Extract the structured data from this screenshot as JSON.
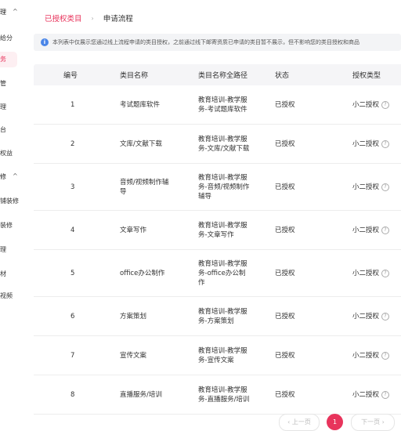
{
  "sidebar": {
    "items": [
      {
        "label": "理",
        "caret": "^"
      },
      {
        "label": "给分"
      },
      {
        "label": "务"
      },
      {
        "label": "管"
      },
      {
        "label": "理"
      },
      {
        "label": "台"
      },
      {
        "label": "权益"
      },
      {
        "label": "修",
        "caret": "^"
      },
      {
        "label": "铺装修"
      },
      {
        "label": "装修"
      },
      {
        "label": "理"
      },
      {
        "label": "材"
      },
      {
        "label": "视频"
      }
    ]
  },
  "breadcrumb": {
    "active": "已授权类目",
    "separator": "›",
    "next": "申请流程"
  },
  "notice": {
    "icon": "info-icon",
    "text": "本列表中仅展示您通过线上流程申请的类目授权，之前通过线下邮寄资质已申请的类目暂不展示，但不影响您的类目授权和商品"
  },
  "table": {
    "headers": [
      "编号",
      "类目名称",
      "类目名称全路径",
      "状态",
      "授权类型"
    ],
    "rows": [
      {
        "id": "1",
        "name": [
          "考试题库软件"
        ],
        "path": [
          "教育培训-教学服",
          "务-考试题库软件"
        ],
        "status": "已授权",
        "type": "小二授权"
      },
      {
        "id": "2",
        "name": [
          "文库/文献下载"
        ],
        "path": [
          "教育培训-教学服",
          "务-文库/文献下载"
        ],
        "status": "已授权",
        "type": "小二授权"
      },
      {
        "id": "3",
        "name": [
          "音频/视频制作辅",
          "导"
        ],
        "path": [
          "教育培训-教学服",
          "务-音频/视频制作",
          "辅导"
        ],
        "status": "已授权",
        "type": "小二授权"
      },
      {
        "id": "4",
        "name": [
          "文章写作"
        ],
        "path": [
          "教育培训-教学服",
          "务-文章写作"
        ],
        "status": "已授权",
        "type": "小二授权"
      },
      {
        "id": "5",
        "name": [
          "office办公制作"
        ],
        "path": [
          "教育培训-教学服",
          "务-office办公制",
          "作"
        ],
        "status": "已授权",
        "type": "小二授权"
      },
      {
        "id": "6",
        "name": [
          "方案策划"
        ],
        "path": [
          "教育培训-教学服",
          "务-方案策划"
        ],
        "status": "已授权",
        "type": "小二授权"
      },
      {
        "id": "7",
        "name": [
          "宣传文案"
        ],
        "path": [
          "教育培训-教学服",
          "务-宣传文案"
        ],
        "status": "已授权",
        "type": "小二授权"
      },
      {
        "id": "8",
        "name": [
          "直播服务/培训"
        ],
        "path": [
          "教育培训-教学服",
          "务-直播服务/培训"
        ],
        "status": "已授权",
        "type": "小二授权"
      }
    ]
  },
  "pagination": {
    "prev": "‹ 上一页",
    "current": "1",
    "next": "下一页 ›"
  },
  "colors": {
    "accent": "#e8345c",
    "info": "#4a86e8"
  }
}
